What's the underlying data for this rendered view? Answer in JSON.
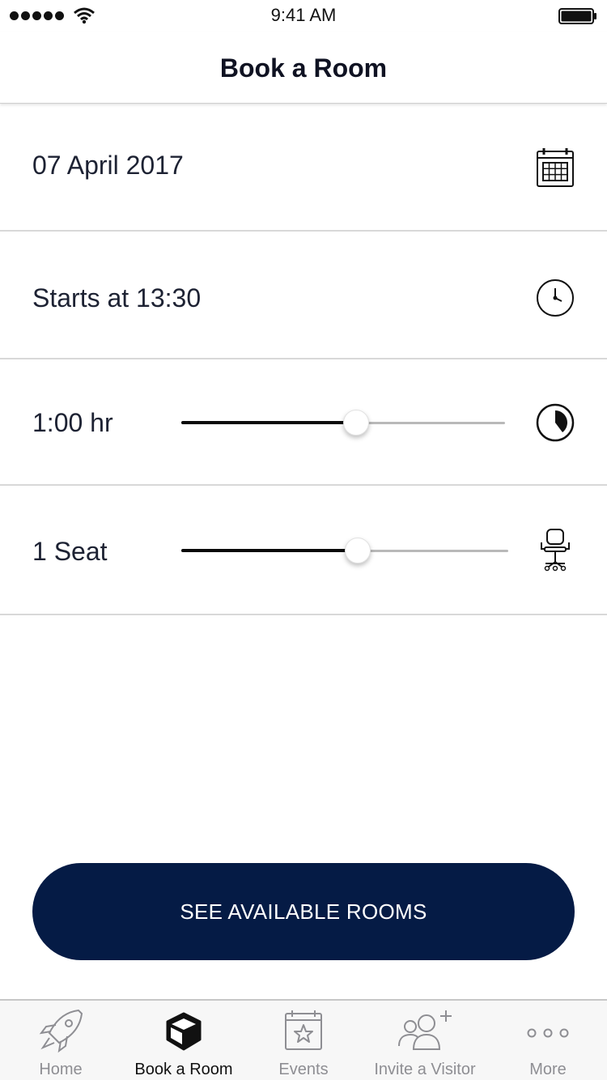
{
  "status_bar": {
    "time": "9:41 AM"
  },
  "header": {
    "title": "Book a Room"
  },
  "booking": {
    "date_label": "07 April 2017",
    "start_label": "Starts at 13:30",
    "duration": {
      "label": "1:00 hr",
      "slider_fraction": 0.54
    },
    "seats": {
      "label": "1 Seat",
      "slider_fraction": 0.54
    }
  },
  "actions": {
    "see_rooms_label": "SEE AVAILABLE ROOMS"
  },
  "tab_bar": {
    "active_index": 1,
    "tabs": [
      {
        "label": "Home",
        "icon": "rocket-icon"
      },
      {
        "label": "Book a Room",
        "icon": "cube-icon"
      },
      {
        "label": "Events",
        "icon": "calendar-star-icon"
      },
      {
        "label": "Invite a Visitor",
        "icon": "add-people-icon"
      },
      {
        "label": "More",
        "icon": "more-dots-icon"
      }
    ]
  },
  "colors": {
    "primary_button": "#051b45",
    "text": "#1d2233",
    "tab_inactive": "#8e8e93",
    "tab_active": "#111111",
    "divider": "#d8d8d8"
  }
}
